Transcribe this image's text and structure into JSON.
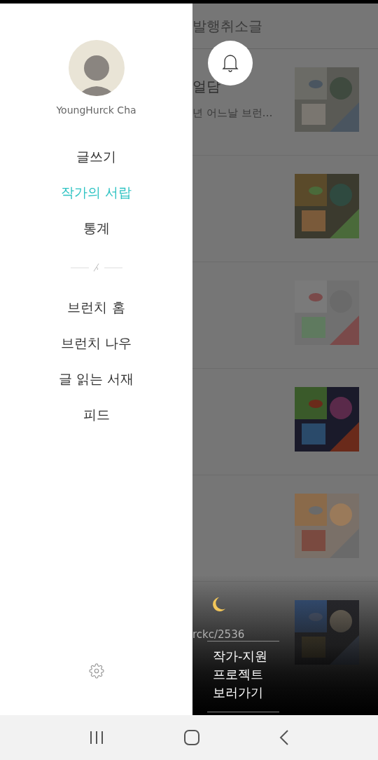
{
  "drawer": {
    "profile": {
      "name": "YoungHurck Cha"
    },
    "primary_menu": [
      {
        "label": "글쓰기",
        "selected": false
      },
      {
        "label": "작가의 서랍",
        "selected": true
      },
      {
        "label": "통계",
        "selected": false
      }
    ],
    "secondary_menu": [
      {
        "label": "브런치 홈",
        "selected": false
      },
      {
        "label": "브런치 나우",
        "selected": false
      },
      {
        "label": "글 읽는 서재",
        "selected": false
      },
      {
        "label": "피드",
        "selected": false
      }
    ]
  },
  "background": {
    "header": "발행취소글",
    "posts": [
      {
        "title": "얼담",
        "excerpt": "년 어느날 브런…",
        "kind": "picture"
      },
      {
        "kind": "picture"
      },
      {
        "kind": "picture"
      },
      {
        "kind": "picture"
      },
      {
        "kind": "picture"
      },
      {
        "kind": "picture",
        "link": "rckc/2536"
      }
    ]
  },
  "banner": {
    "lines": [
      "작가-지원",
      "프로젝트",
      "보러가기"
    ]
  }
}
